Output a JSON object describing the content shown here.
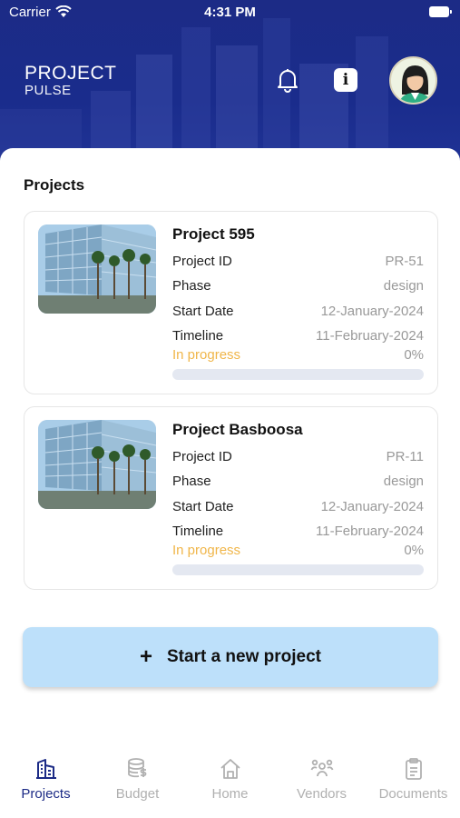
{
  "status_bar": {
    "carrier": "Carrier",
    "time": "4:31 PM"
  },
  "header": {
    "logo_top": "PROJECT",
    "logo_bottom": "PULSE",
    "icons": [
      "bell-icon",
      "info-icon",
      "avatar"
    ]
  },
  "section_title": "Projects",
  "projects": [
    {
      "name": "Project 595",
      "id_label": "Project ID",
      "id_value": "PR-51",
      "phase_label": "Phase",
      "phase_value": "design",
      "start_label": "Start Date",
      "start_value": "12-January-2024",
      "timeline_label": "Timeline",
      "timeline_value": "11-February-2024",
      "status": "In progress",
      "progress_text": "0%",
      "progress": 0
    },
    {
      "name": "Project Basboosa",
      "id_label": "Project ID",
      "id_value": "PR-11",
      "phase_label": "Phase",
      "phase_value": "design",
      "start_label": "Start Date",
      "start_value": "12-January-2024",
      "timeline_label": "Timeline",
      "timeline_value": "11-February-2024",
      "status": "In progress",
      "progress_text": "0%",
      "progress": 0
    }
  ],
  "new_project_button": {
    "label": "Start a new project",
    "icon": "plus-icon"
  },
  "tabs": [
    {
      "label": "Projects",
      "icon": "building-icon",
      "active": true
    },
    {
      "label": "Budget",
      "icon": "budget-icon",
      "active": false
    },
    {
      "label": "Home",
      "icon": "home-icon",
      "active": false
    },
    {
      "label": "Vendors",
      "icon": "vendors-icon",
      "active": false
    },
    {
      "label": "Documents",
      "icon": "clipboard-icon",
      "active": false
    }
  ],
  "colors": {
    "header_bg": "#1c2b86",
    "accent": "#1c2b86",
    "status_in_progress": "#f0b64a",
    "button_bg": "#bde0fa",
    "inactive_tab": "#b0b0b0"
  }
}
